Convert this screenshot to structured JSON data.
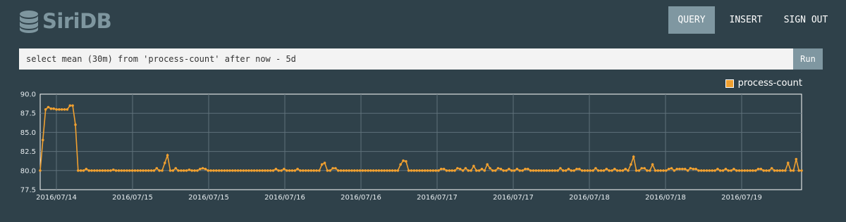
{
  "app": {
    "logo_text": "SiriDB"
  },
  "nav": {
    "query": "QUERY",
    "insert": "INSERT",
    "sign_out": "SIGN OUT"
  },
  "query": {
    "value": "select mean (30m) from 'process-count' after now - 5d",
    "run_label": "Run"
  },
  "colors": {
    "accent": "#7f97a1",
    "series": "#f0a030",
    "background": "#2f414a"
  },
  "chart_data": {
    "type": "line",
    "series": [
      {
        "name": "process-count",
        "values": [
          80,
          84,
          88,
          88.3,
          88.1,
          88.1,
          88,
          88,
          88,
          88,
          88,
          88.5,
          88.5,
          86,
          80,
          80,
          80,
          80.2,
          80,
          80,
          80,
          80,
          80,
          80,
          80,
          80,
          80,
          80.1,
          80,
          80,
          80,
          80,
          80,
          80,
          80,
          80,
          80,
          80,
          80,
          80,
          80,
          80,
          80,
          80.3,
          80,
          80,
          81,
          82,
          80,
          80,
          80.3,
          80,
          80,
          80,
          80,
          80.1,
          80,
          80,
          80,
          80.2,
          80.3,
          80.2,
          80,
          80,
          80,
          80,
          80,
          80,
          80,
          80,
          80,
          80,
          80,
          80,
          80,
          80,
          80,
          80,
          80,
          80,
          80,
          80,
          80,
          80,
          80,
          80,
          80,
          80.2,
          80,
          80,
          80.2,
          80,
          80,
          80,
          80,
          80.2,
          80,
          80,
          80,
          80,
          80,
          80,
          80,
          80,
          80.8,
          81,
          80,
          80,
          80.3,
          80.3,
          80,
          80,
          80,
          80,
          80,
          80,
          80,
          80,
          80,
          80,
          80,
          80,
          80,
          80,
          80,
          80,
          80,
          80,
          80,
          80,
          80,
          80,
          80,
          80.8,
          81.3,
          81.2,
          80,
          80,
          80,
          80,
          80,
          80,
          80,
          80,
          80,
          80,
          80,
          80,
          80.2,
          80.2,
          80,
          80,
          80,
          80,
          80.3,
          80.2,
          80,
          80.3,
          80,
          80,
          80.6,
          80,
          80,
          80.2,
          80,
          80.8,
          80.3,
          80,
          80,
          80.3,
          80.2,
          80,
          80,
          80.2,
          80,
          80,
          80.2,
          80,
          80,
          80.2,
          80.2,
          80,
          80,
          80,
          80,
          80,
          80,
          80,
          80,
          80,
          80,
          80,
          80.3,
          80,
          80,
          80.2,
          80,
          80,
          80.2,
          80.2,
          80,
          80,
          80,
          80,
          80,
          80.3,
          80,
          80,
          80,
          80.2,
          80,
          80,
          80.2,
          80,
          80,
          80,
          80.2,
          80,
          80.8,
          81.8,
          80,
          80,
          80.3,
          80.3,
          80,
          80,
          80.8,
          80,
          80,
          80,
          80,
          80,
          80.2,
          80.3,
          80,
          80.2,
          80.2,
          80.2,
          80.2,
          80,
          80.3,
          80.2,
          80.2,
          80,
          80,
          80,
          80,
          80,
          80,
          80,
          80.2,
          80,
          80,
          80.2,
          80,
          80,
          80.2,
          80,
          80,
          80,
          80,
          80,
          80,
          80,
          80,
          80.2,
          80.2,
          80,
          80,
          80,
          80.3,
          80,
          80,
          80,
          80,
          80,
          81,
          80,
          80,
          81.5,
          80,
          80
        ]
      }
    ],
    "x_tick_labels": [
      "2016/07/14",
      "2016/07/15",
      "2016/07/15",
      "2016/07/16",
      "2016/07/16",
      "2016/07/17",
      "2016/07/17",
      "2016/07/18",
      "2016/07/18",
      "2016/07/19"
    ],
    "y_tick_labels": [
      "90.0",
      "87.5",
      "85.0",
      "82.5",
      "80.0",
      "77.5"
    ],
    "ylim": [
      77.5,
      90
    ],
    "grid": true,
    "legend_position": "top-right"
  }
}
